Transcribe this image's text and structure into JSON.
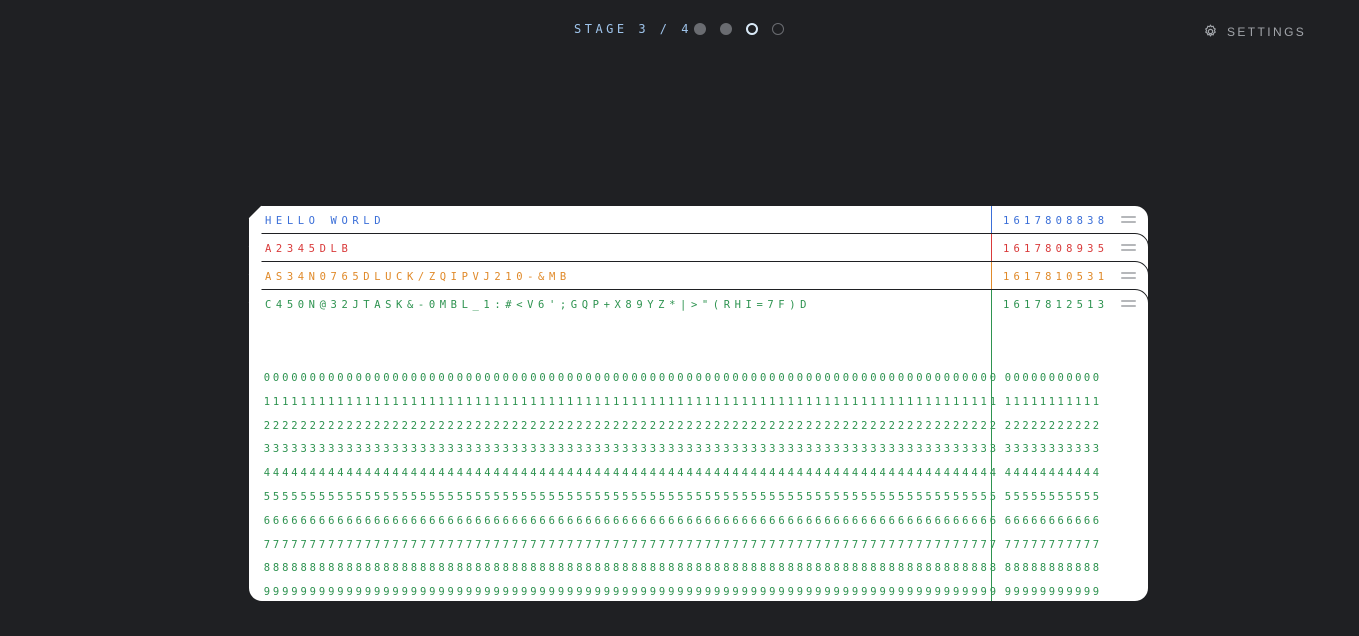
{
  "progress": {
    "label": "STAGE 3 / 4",
    "current": 3,
    "total": 4
  },
  "settings": {
    "label": "SETTINGS",
    "icon": "gear-icon"
  },
  "colors": {
    "background": "#1f2023",
    "card": "#ffffff",
    "blue": "#3b6fd8",
    "red": "#d93a3a",
    "orange": "#e08a2a",
    "green": "#2e9350",
    "punch": "#000000"
  },
  "cards": [
    {
      "text": "HELLO WORLD",
      "number": "1617808838",
      "color": "#3b6fd8"
    },
    {
      "text": "A2345DLB",
      "number": "1617808935",
      "color": "#d93a3a"
    },
    {
      "text": "AS34N0765DLUCK/ZQIPVJ210-&MB",
      "number": "1617810531",
      "color": "#e08a2a"
    },
    {
      "text": "C450N@32JTASK&-0MBL_1:#<V6';GQP+X89YZ*|>\"(RHI=7F)D",
      "number": "1617812513",
      "color": "#2e9350"
    }
  ],
  "punch_grid": {
    "digits": [
      "0",
      "1",
      "2",
      "3",
      "4",
      "5",
      "6",
      "7",
      "8",
      "9"
    ]
  }
}
